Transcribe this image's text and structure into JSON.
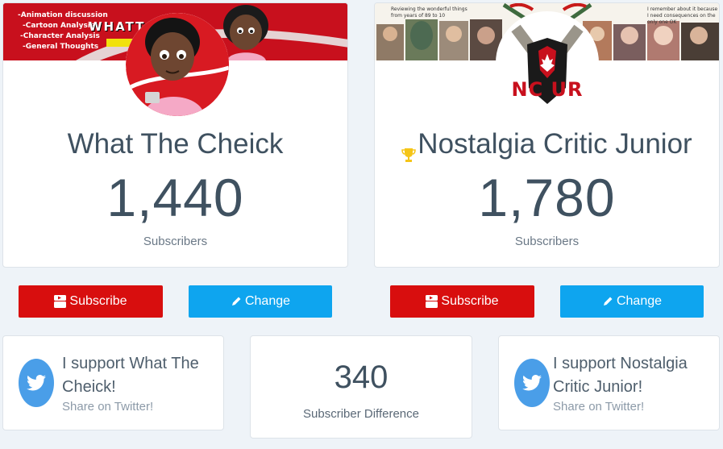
{
  "left_channel": {
    "banner_lines": [
      "-Animation discussion",
      "-Cartoon Analysis",
      "-Character Analysis",
      "-General Thoughts"
    ],
    "banner_logo": "WHATT",
    "name": "What The Cheick",
    "subscribers": "1,440",
    "subscribers_label": "Subscribers",
    "subscribe_label": "Subscribe",
    "change_label": "Change",
    "support_line": "I support What The Cheick!",
    "share_label": "Share on Twitter!"
  },
  "right_channel": {
    "banner_text_left": "Reviewing the wonderful things from years of 89 to 10",
    "banner_text_right": "I remember about it because I need consequences on the only one OK",
    "logo_text": "NC UR",
    "trophy_icon": "trophy-icon",
    "name": "Nostalgia Critic Junior",
    "subscribers": "1,780",
    "subscribers_label": "Subscribers",
    "subscribe_label": "Subscribe",
    "change_label": "Change",
    "support_line": "I support Nostalgia Critic Junior!",
    "share_label": "Share on Twitter!"
  },
  "difference": {
    "value": "340",
    "label": "Subscriber Difference"
  },
  "colors": {
    "subscribe": "#d80e0e",
    "change": "#0ea5ef",
    "twitter": "#4a9ee8",
    "page_bg": "#eef3f8"
  }
}
